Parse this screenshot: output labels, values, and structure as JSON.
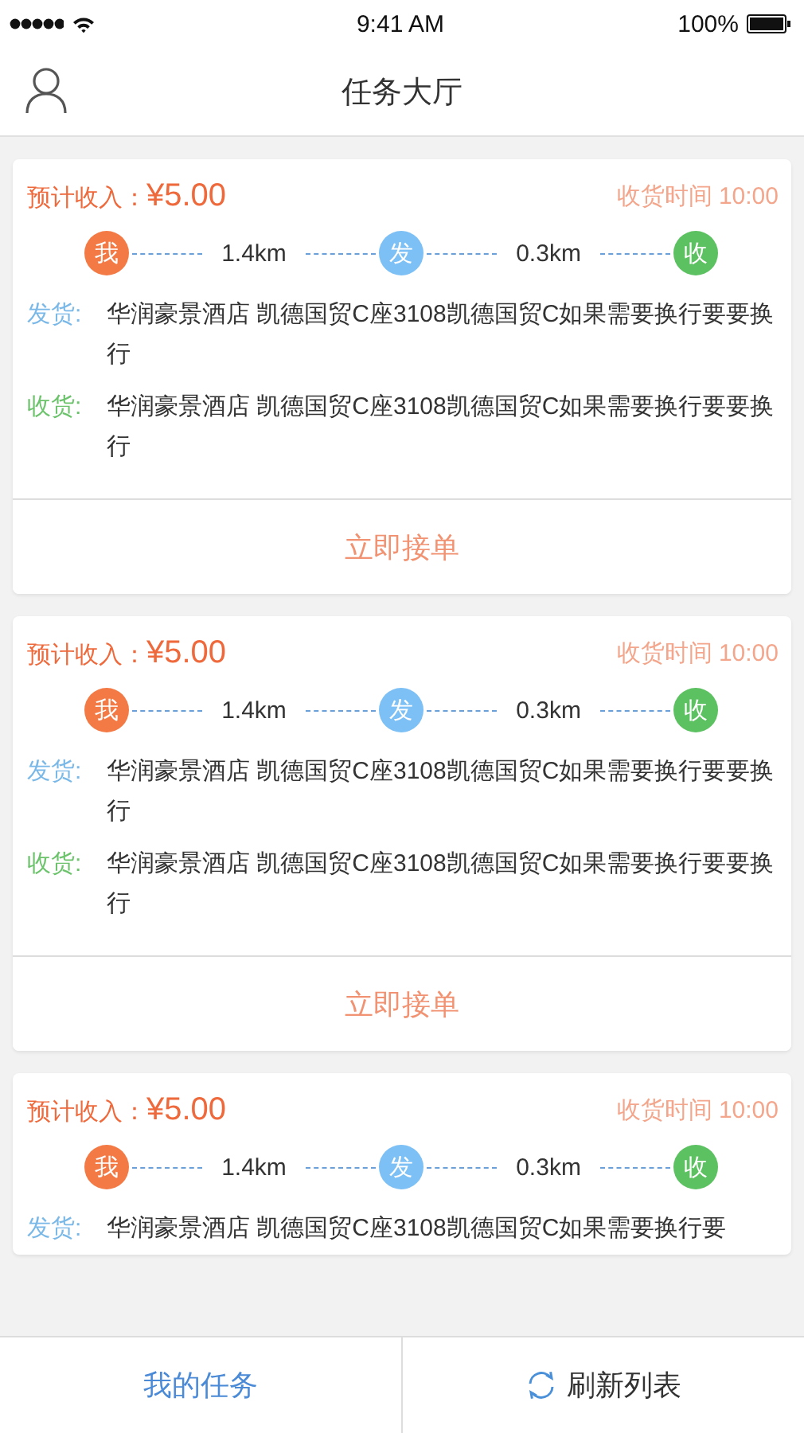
{
  "status_bar": {
    "time": "9:41 AM",
    "battery": "100%"
  },
  "nav": {
    "title": "任务大厅"
  },
  "tasks": [
    {
      "income_label": "预计收入：",
      "income": "¥5.00",
      "delivery_time": "收货时间 10:00",
      "route": [
        {
          "kind": "node",
          "label": "我",
          "color": "#f47a45"
        },
        {
          "kind": "distance",
          "text": "1.4km"
        },
        {
          "kind": "node",
          "label": "发",
          "color": "#7cc0f5"
        },
        {
          "kind": "distance",
          "text": "0.3km"
        },
        {
          "kind": "node",
          "label": "收",
          "color": "#5cc160"
        }
      ],
      "addresses": [
        {
          "kind": "send",
          "label": "发货:",
          "text": "华润豪景酒店 凯德国贸C座3108凯德国贸C如果需要换行要要换行"
        },
        {
          "kind": "receive",
          "label": "收货:",
          "text": "华润豪景酒店 凯德国贸C座3108凯德国贸C如果需要换行要要换行"
        }
      ],
      "action": "立即接单"
    },
    {
      "income_label": "预计收入：",
      "income": "¥5.00",
      "delivery_time": "收货时间 10:00",
      "route": [
        {
          "kind": "node",
          "label": "我",
          "color": "#f47a45"
        },
        {
          "kind": "distance",
          "text": "1.4km"
        },
        {
          "kind": "node",
          "label": "发",
          "color": "#7cc0f5"
        },
        {
          "kind": "distance",
          "text": "0.3km"
        },
        {
          "kind": "node",
          "label": "收",
          "color": "#5cc160"
        }
      ],
      "addresses": [
        {
          "kind": "send",
          "label": "发货:",
          "text": "华润豪景酒店 凯德国贸C座3108凯德国贸C如果需要换行要要换行"
        },
        {
          "kind": "receive",
          "label": "收货:",
          "text": "华润豪景酒店 凯德国贸C座3108凯德国贸C如果需要换行要要换行"
        }
      ],
      "action": "立即接单"
    },
    {
      "income_label": "预计收入：",
      "income": "¥5.00",
      "delivery_time": "收货时间 10:00",
      "route": [
        {
          "kind": "node",
          "label": "我",
          "color": "#f47a45"
        },
        {
          "kind": "distance",
          "text": "1.4km"
        },
        {
          "kind": "node",
          "label": "发",
          "color": "#7cc0f5"
        },
        {
          "kind": "distance",
          "text": "0.3km"
        },
        {
          "kind": "node",
          "label": "收",
          "color": "#5cc160"
        }
      ],
      "addresses": [
        {
          "kind": "send",
          "label": "发货:",
          "text": "华润豪景酒店 凯德国贸C座3108凯德国贸C如果需要换行要"
        }
      ]
    }
  ],
  "tab_bar": [
    {
      "kind": "text",
      "label": "我的任务"
    },
    {
      "kind": "refresh",
      "label": "刷新列表"
    }
  ]
}
